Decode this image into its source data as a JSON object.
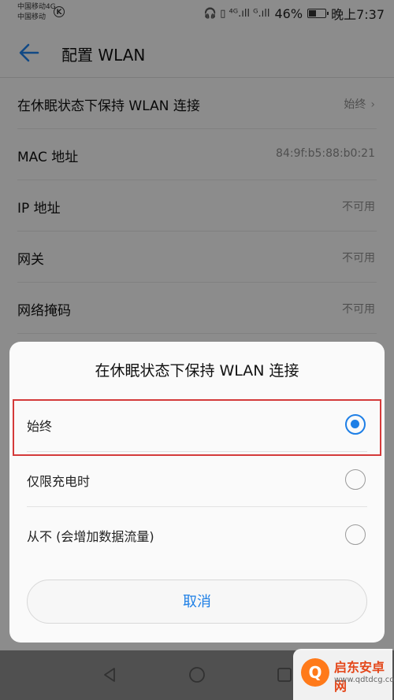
{
  "status_bar": {
    "carrier_1": "中国移动4G",
    "carrier_2": "中国移动",
    "k_badge": "K",
    "signal_icons": "🎧 ▯ ⁴ᴳ.ıll ᴳ.ıll",
    "battery_percent": "46%",
    "battery_level": 0.46,
    "time": "晚上7:37"
  },
  "app_bar": {
    "title": "配置 WLAN",
    "back_icon": "arrow-left-icon"
  },
  "settings": [
    {
      "label": "在休眠状态下保持 WLAN 连接",
      "value": "始终",
      "has_chevron": true
    },
    {
      "label": "MAC 地址",
      "value": "84:9f:b5:88:b0:21",
      "has_chevron": false
    },
    {
      "label": "IP 地址",
      "value": "不可用",
      "has_chevron": false
    },
    {
      "label": "网关",
      "value": "不可用",
      "has_chevron": false
    },
    {
      "label": "网络掩码",
      "value": "不可用",
      "has_chevron": false
    }
  ],
  "dialog": {
    "title": "在休眠状态下保持 WLAN 连接",
    "options": [
      {
        "label": "始终",
        "selected": true
      },
      {
        "label": "仅限充电时",
        "selected": false
      },
      {
        "label": "从不 (会增加数据流量)",
        "selected": false
      }
    ],
    "cancel_label": "取消"
  },
  "watermark": {
    "logo_char": "Q",
    "title": "启东安卓网",
    "subtitle": "www.qdtdcg.com"
  },
  "colors": {
    "accent": "#1e7fe6",
    "highlight": "#d43a3a"
  }
}
